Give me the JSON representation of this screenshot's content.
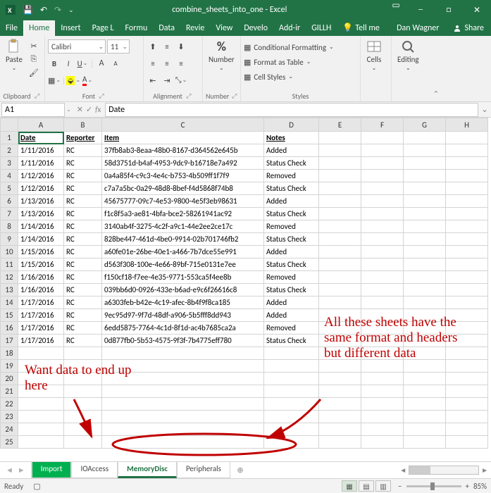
{
  "title": "combine_sheets_into_one - Excel",
  "user": "Dan Wagner",
  "share_label": "Share",
  "tell_me": "Tell me",
  "menu": [
    "File",
    "Home",
    "Insert",
    "Page L",
    "Formu",
    "Data",
    "Revie",
    "View",
    "Develo",
    "Add-ir",
    "GILLH"
  ],
  "active_menu": "Home",
  "ribbon": {
    "clipboard": {
      "paste": "Paste",
      "label": "Clipboard"
    },
    "font": {
      "name": "Calibri",
      "size": "11",
      "label": "Font"
    },
    "alignment": {
      "label": "Alignment"
    },
    "number": {
      "label": "Number",
      "btn": "Number"
    },
    "styles": {
      "cond": "Conditional Formatting",
      "table": "Format as Table",
      "cell": "Cell Styles",
      "label": "Styles"
    },
    "cells": {
      "btn": "Cells"
    },
    "editing": {
      "btn": "Editing"
    }
  },
  "name_box": "A1",
  "formula": "Date",
  "columns": [
    "A",
    "B",
    "C",
    "D",
    "E",
    "F",
    "G",
    "H"
  ],
  "headers": {
    "A": "Date",
    "B": "Reporter",
    "C": "Item",
    "D": "Notes"
  },
  "rows": [
    {
      "r": 2,
      "A": "1/11/2016",
      "B": "RC",
      "C": "37fb8ab3-8eaa-48b0-8167-d364562e645b",
      "D": "Added"
    },
    {
      "r": 3,
      "A": "1/11/2016",
      "B": "RC",
      "C": "58d3751d-b4af-4953-9dc9-b16718e7a492",
      "D": "Status Check"
    },
    {
      "r": 4,
      "A": "1/12/2016",
      "B": "RC",
      "C": "0a4a85f4-c9c3-4e4c-b753-4b509ff1f7f9",
      "D": "Removed"
    },
    {
      "r": 5,
      "A": "1/12/2016",
      "B": "RC",
      "C": "c7a7a5bc-0a29-48d8-8bef-f4d5868f74b8",
      "D": "Status Check"
    },
    {
      "r": 6,
      "A": "1/13/2016",
      "B": "RC",
      "C": "45675777-09c7-4e53-9800-4e5f3eb98631",
      "D": "Added"
    },
    {
      "r": 7,
      "A": "1/13/2016",
      "B": "RC",
      "C": "f1c8f5a3-ae81-4bfa-bce2-58261941ac92",
      "D": "Status Check"
    },
    {
      "r": 8,
      "A": "1/14/2016",
      "B": "RC",
      "C": "3140ab4f-3275-4c2f-a9c1-44e2ee2ce17c",
      "D": "Removed"
    },
    {
      "r": 9,
      "A": "1/14/2016",
      "B": "RC",
      "C": "828be447-461d-4be0-9914-02b701746fb2",
      "D": "Status Check"
    },
    {
      "r": 10,
      "A": "1/15/2016",
      "B": "RC",
      "C": "a60fe01e-26be-40e1-a466-7b7dce55e991",
      "D": "Added"
    },
    {
      "r": 11,
      "A": "1/15/2016",
      "B": "RC",
      "C": "d563f308-100e-4e66-89bf-715e0131e7ee",
      "D": "Status Check"
    },
    {
      "r": 12,
      "A": "1/16/2016",
      "B": "RC",
      "C": "f150cf18-f7ee-4e35-9771-553ca5f4ee8b",
      "D": "Removed"
    },
    {
      "r": 13,
      "A": "1/16/2016",
      "B": "RC",
      "C": "039bb6d0-0926-433e-b6ad-e9c6f26616c8",
      "D": "Status Check"
    },
    {
      "r": 14,
      "A": "1/17/2016",
      "B": "RC",
      "C": "a6303feb-b42e-4c19-afec-8b4f9f8ca185",
      "D": "Added"
    },
    {
      "r": 15,
      "A": "1/17/2016",
      "B": "RC",
      "C": "9ec95d97-9f7d-48df-a906-5b5fff8dd943",
      "D": "Added"
    },
    {
      "r": 16,
      "A": "1/17/2016",
      "B": "RC",
      "C": "6edd5875-7764-4c1d-8f1d-ac4b7685ca2a",
      "D": "Removed"
    },
    {
      "r": 17,
      "A": "1/17/2016",
      "B": "RC",
      "C": "0d877fb0-5b53-4575-9f3f-7b4775eff780",
      "D": "Status Check"
    }
  ],
  "empty_rows": [
    18,
    19,
    20,
    21,
    22,
    23,
    24,
    25
  ],
  "sheets": [
    "Import",
    "IOAccess",
    "MemoryDisc",
    "Peripherals"
  ],
  "active_sheet": "MemoryDisc",
  "status": "Ready",
  "zoom": "85%",
  "anno1": "Want data to end up here",
  "anno2": "All these sheets have the same format and headers but different data"
}
